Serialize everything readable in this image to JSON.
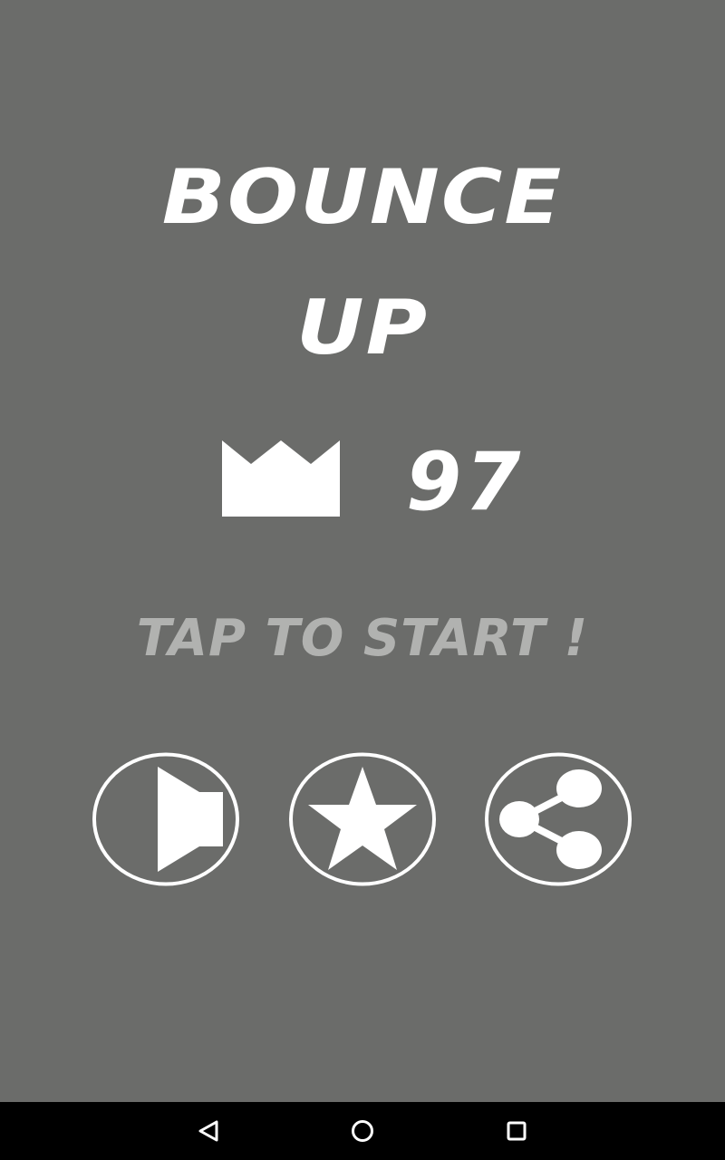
{
  "title": {
    "line1": "BOUNCE",
    "line2": "UP"
  },
  "best": {
    "icon": "crown-icon",
    "score": "97"
  },
  "prompt": "TAP TO START !",
  "buttons": [
    {
      "name": "sound",
      "icon": "speaker-icon"
    },
    {
      "name": "rate",
      "icon": "star-icon"
    },
    {
      "name": "share",
      "icon": "share-icon"
    }
  ],
  "nav_bar": {
    "back_icon": "back-triangle-icon",
    "home_icon": "home-circle-icon",
    "recent_icon": "recent-apps-square-icon"
  },
  "colors": {
    "background": "#6b6c6a",
    "foreground": "#ffffff",
    "prompt": "#b1b2b0",
    "nav_bar": "#000000"
  }
}
